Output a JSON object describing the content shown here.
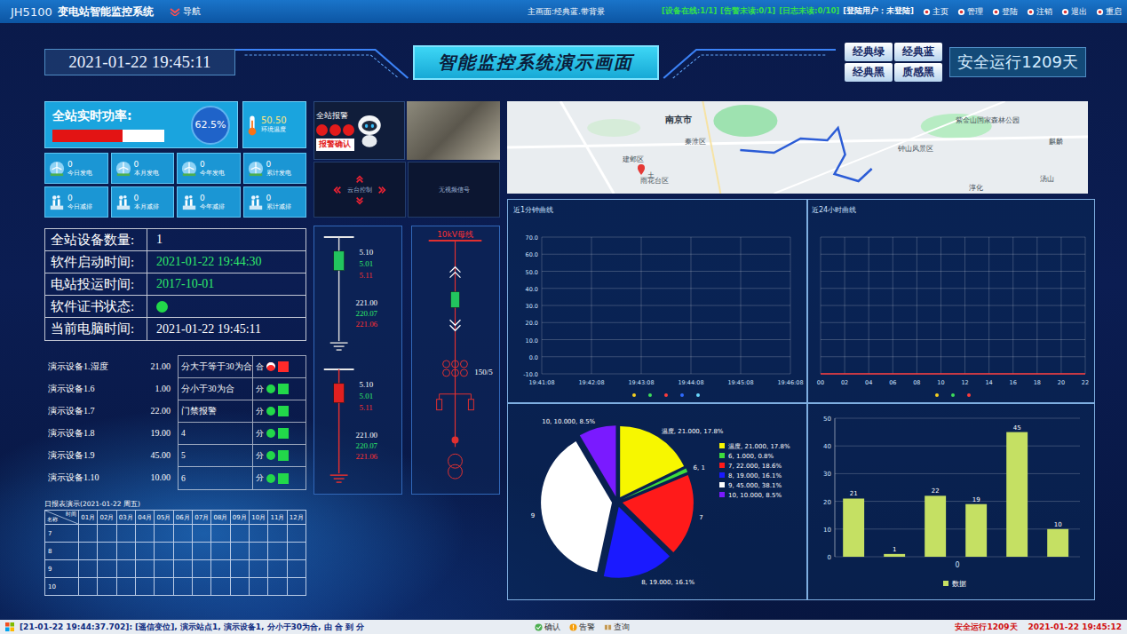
{
  "topbar": {
    "app_code": "JH5100",
    "title": "变电站智能监控系统",
    "nav": "导航",
    "screen": "主画面:经典蓝.带背景",
    "status": [
      {
        "text": "[设备在线:1/1]",
        "color": "#33e04a"
      },
      {
        "text": "[告警未读:0/1]",
        "color": "#33e04a"
      },
      {
        "text": "[日志未读:0/10]",
        "color": "#33e04a"
      },
      {
        "text": "[登陆用户：未登陆]",
        "color": "#ffffff"
      }
    ],
    "menu": [
      "主页",
      "管理",
      "登陆",
      "注销",
      "退出",
      "重启"
    ]
  },
  "header": {
    "datetime": "2021-01-22 19:45:11",
    "title": "智能监控系统演示画面",
    "themes": [
      "经典绿",
      "经典蓝",
      "经典黑",
      "质感黑"
    ],
    "safety": "安全运行1209天"
  },
  "power": {
    "label": "全站实时功率:",
    "level": 0.625,
    "percent": "62.5%"
  },
  "temperature": {
    "value": "50.50",
    "label": "环境温度"
  },
  "stats": [
    {
      "value": "0",
      "label": "今日发电",
      "kind": "wind"
    },
    {
      "value": "0",
      "label": "本月发电",
      "kind": "wind"
    },
    {
      "value": "0",
      "label": "今年发电",
      "kind": "wind"
    },
    {
      "value": "0",
      "label": "累计发电",
      "kind": "wind"
    },
    {
      "value": "0",
      "label": "今日减排",
      "kind": "factory"
    },
    {
      "value": "0",
      "label": "本月减排",
      "kind": "factory"
    },
    {
      "value": "0",
      "label": "今年减排",
      "kind": "factory"
    },
    {
      "value": "0",
      "label": "累计减排",
      "kind": "factory"
    }
  ],
  "info": [
    {
      "label": "全站设备数量:",
      "kind": "text",
      "value": "1",
      "color": "#ffffff"
    },
    {
      "label": "软件启动时间:",
      "kind": "text",
      "value": "2021-01-22 19:44:30",
      "color": "#2ee86a"
    },
    {
      "label": "电站投运时间:",
      "kind": "text",
      "value": "2017-10-01",
      "color": "#2ee86a"
    },
    {
      "label": "软件证书状态:",
      "kind": "status",
      "ok": true
    },
    {
      "label": "当前电脑时间:",
      "kind": "text",
      "value": "2021-01-22 19:45:11",
      "color": "#ffffff"
    }
  ],
  "devices": [
    {
      "name": "演示设备1.湿度",
      "value": "21.00"
    },
    {
      "name": "演示设备1.6",
      "value": "1.00"
    },
    {
      "name": "演示设备1.7",
      "value": "22.00"
    },
    {
      "name": "演示设备1.8",
      "value": "19.00"
    },
    {
      "name": "演示设备1.9",
      "value": "45.00"
    },
    {
      "name": "演示设备1.10",
      "value": "10.00"
    }
  ],
  "switches": [
    {
      "name": "分大于等于30为合",
      "state": "合",
      "closed": true
    },
    {
      "name": "分小于30为合",
      "state": "分",
      "closed": false
    },
    {
      "name": "门禁报警",
      "state": "分",
      "closed": false
    },
    {
      "name": "4",
      "state": "分",
      "closed": false
    },
    {
      "name": "5",
      "state": "分",
      "closed": false
    },
    {
      "name": "6",
      "state": "分",
      "closed": false
    }
  ],
  "report": {
    "title": "日报表演示(2021-01-22 周五)",
    "corner_top": "时间",
    "corner_bottom": "名称",
    "columns": [
      "01月",
      "02月",
      "03月",
      "04月",
      "05月",
      "06月",
      "07月",
      "08月",
      "09月",
      "10月",
      "11月",
      "12月"
    ],
    "rows": [
      "7",
      "8",
      "9",
      "10"
    ]
  },
  "alarm": {
    "title": "全站报警",
    "lamps": [
      {
        "active": true
      },
      {
        "active": true
      },
      {
        "active": true
      }
    ],
    "ack": "报警确认"
  },
  "ptz": {
    "label": "云台控制"
  },
  "video": {
    "label": "无视频信号"
  },
  "bays": [
    {
      "closed": false,
      "readings": [
        {
          "text": "5.10",
          "color": "#ffffff"
        },
        {
          "text": "5.01",
          "color": "#2ee86a"
        },
        {
          "text": "5.11",
          "color": "#ff3030"
        }
      ],
      "voltages": [
        {
          "text": "221.00",
          "color": "#ffffff"
        },
        {
          "text": "220.07",
          "color": "#2ee86a"
        },
        {
          "text": "221.06",
          "color": "#ff3030"
        }
      ]
    },
    {
      "closed": true,
      "readings": [
        {
          "text": "5.10",
          "color": "#ffffff"
        },
        {
          "text": "5.01",
          "color": "#2ee86a"
        },
        {
          "text": "5.11",
          "color": "#ff3030"
        }
      ],
      "voltages": [
        {
          "text": "221.00",
          "color": "#ffffff"
        },
        {
          "text": "220.07",
          "color": "#2ee86a"
        },
        {
          "text": "221.06",
          "color": "#ff3030"
        }
      ]
    }
  ],
  "feeder": {
    "bus": "10kV母线",
    "breaker_closed": false,
    "ct": "150/5"
  },
  "map": {
    "labels": [
      "南京市",
      "秦淮区",
      "建邺区",
      "雨花台区",
      "钟山风景区",
      "紫金山国家森林公园",
      "麒麟",
      "汤山",
      "淳化",
      "土"
    ]
  },
  "charts": {
    "minute": {
      "title": "近1分钟曲线",
      "y_ticks": [
        "70.0",
        "60.0",
        "50.0",
        "40.0",
        "30.0",
        "20.0",
        "10.0",
        "0.0",
        "-10.0"
      ],
      "x_ticks": [
        "19:41:08",
        "19:42:08",
        "19:43:08",
        "19:44:08",
        "19:45:08",
        "19:46:08"
      ],
      "series": [
        {
          "color": "#f5d020",
          "values": []
        },
        {
          "color": "#3ddc5a",
          "values": []
        },
        {
          "color": "#ff3b3b",
          "values": []
        },
        {
          "color": "#2f6bff",
          "values": []
        },
        {
          "color": "#6ad8ff",
          "values": []
        }
      ]
    },
    "day": {
      "title": "近24小时曲线",
      "y_ticks": [],
      "x_ticks": [
        "00",
        "02",
        "04",
        "06",
        "08",
        "10",
        "12",
        "14",
        "16",
        "18",
        "20",
        "22"
      ],
      "series": [
        {
          "color": "#f5d020",
          "values": []
        },
        {
          "color": "#3ddc5a",
          "values": []
        },
        {
          "color": "#ff3b3b",
          "values": [
            0,
            0,
            0,
            0,
            0,
            0,
            0,
            0,
            0,
            0,
            0,
            0
          ]
        }
      ]
    },
    "pie": {
      "slices": [
        {
          "value": 21,
          "label": "温度, 21.000, 17.8%",
          "legend": "温度, 21.000, 17.8%",
          "color": "#f7f700"
        },
        {
          "value": 1,
          "label": "6, 1",
          "legend": "6, 1.000, 0.8%",
          "color": "#3ddc3d"
        },
        {
          "value": 22,
          "label": "7",
          "legend": "7, 22.000, 18.6%",
          "color": "#ff1a1a"
        },
        {
          "value": 19,
          "label": "8, 19.000, 16.1%",
          "legend": "8, 19.000, 16.1%",
          "color": "#1a1aff"
        },
        {
          "value": 45,
          "label": "9",
          "legend": "9, 45.000, 38.1%",
          "color": "#ffffff"
        },
        {
          "value": 10,
          "label": "10, 10.000, 8.5%",
          "legend": "10, 10.000, 8.5%",
          "color": "#7a1aff"
        }
      ]
    },
    "bar": {
      "y_ticks": [
        "50",
        "40",
        "30",
        "20",
        "10",
        "0"
      ],
      "category": "0",
      "legend": "数据",
      "color": "#c5e063",
      "values": [
        21,
        1,
        22,
        19,
        45,
        10
      ],
      "labels": [
        "21",
        "1",
        "22",
        "19",
        "45",
        "10"
      ]
    }
  },
  "status_bar": {
    "message": "[21-01-22 19:44:37.702]: [遥信变位], 演示站点1, 演示设备1, 分小于30为合, 由 合 到 分",
    "buttons": [
      {
        "label": "确认",
        "kind": "confirm"
      },
      {
        "label": "告警",
        "kind": "alarm"
      },
      {
        "label": "查询",
        "kind": "query"
      }
    ],
    "safety": "安全运行1209天",
    "time": "2021-01-22 19:45:12"
  }
}
